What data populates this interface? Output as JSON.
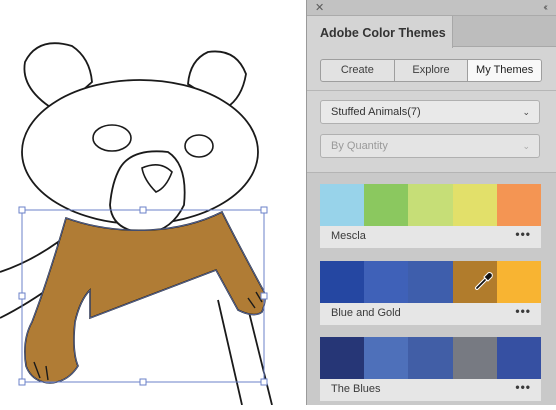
{
  "colors": {
    "bear_fur": "#b07c35",
    "outline": "#1a1a1a",
    "selection": "#6b82c8",
    "panel_bg": "#d4d4d4"
  },
  "panel": {
    "title": "Adobe Color Themes",
    "close_icon": "close-icon",
    "collapse_icon": "collapse-panel-icon",
    "tabs": [
      "Create",
      "Explore",
      "My Themes"
    ],
    "active_tab": "My Themes",
    "library": {
      "selected": "Stuffed Animals(7)"
    },
    "sort": {
      "selected": "By Quantity"
    },
    "more_label": "•••"
  },
  "themes": [
    {
      "name": "Mescla",
      "colors": [
        "#98d3ea",
        "#8bc85f",
        "#c6de77",
        "#e2e06a",
        "#f49553"
      ]
    },
    {
      "name": "Blue and Gold",
      "colors": [
        "#2547a2",
        "#3f61b8",
        "#3e5eac",
        "#b17c2c",
        "#f8b432"
      ],
      "active_swatch": 3
    },
    {
      "name": "The Blues",
      "colors": [
        "#263676",
        "#4e70ba",
        "#415ea6",
        "#777a82",
        "#3650a2"
      ]
    }
  ]
}
